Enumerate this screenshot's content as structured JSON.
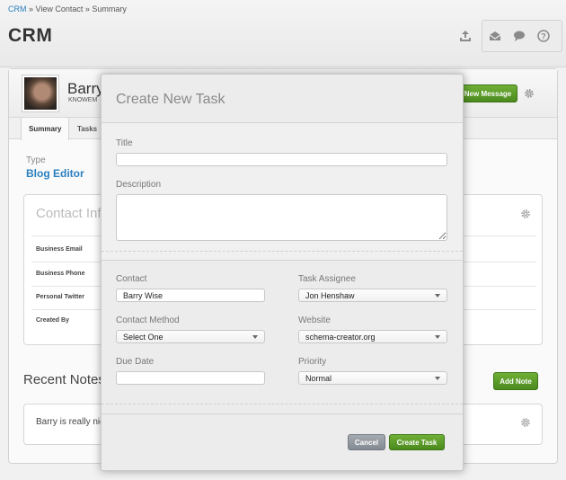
{
  "header": {
    "breadcrumb": {
      "crm": "CRM",
      "sep1": " » ",
      "view_contact": "View Contact",
      "sep2": " » ",
      "summary": "Summary"
    },
    "title": "CRM",
    "icons": [
      "upload-icon",
      "mail-icon",
      "chat-icon",
      "help-icon"
    ]
  },
  "contact": {
    "name": "Barry",
    "company": "KNOWEM",
    "new_message_label": "New Message",
    "tabs": [
      {
        "label": "Summary",
        "active": true
      },
      {
        "label": "Tasks",
        "active": false
      }
    ],
    "type_label": "Type",
    "type_value": "Blog Editor",
    "info_title": "Contact Inf",
    "info_rows": [
      "Business Email",
      "Business Phone",
      "Personal Twitter",
      "Created By"
    ],
    "notes_title": "Recent Notes",
    "add_note_label": "Add Note",
    "note_text": "Barry is really nic"
  },
  "modal": {
    "title": "Create New Task",
    "title_label": "Title",
    "title_value": "",
    "description_label": "Description",
    "contact_label": "Contact",
    "contact_value": "Barry Wise",
    "assignee_label": "Task Assignee",
    "assignee_value": "Jon Henshaw",
    "method_label": "Contact Method",
    "method_value": "Select One",
    "website_label": "Website",
    "website_value": "schema-creator.org",
    "due_label": "Due Date",
    "due_value": "",
    "priority_label": "Priority",
    "priority_value": "Normal",
    "cancel_label": "Cancel",
    "create_label": "Create Task"
  },
  "colors": {
    "accent_green": "#5a9a28",
    "link_blue": "#2a7fc0",
    "cancel_gray": "#939aa2"
  }
}
